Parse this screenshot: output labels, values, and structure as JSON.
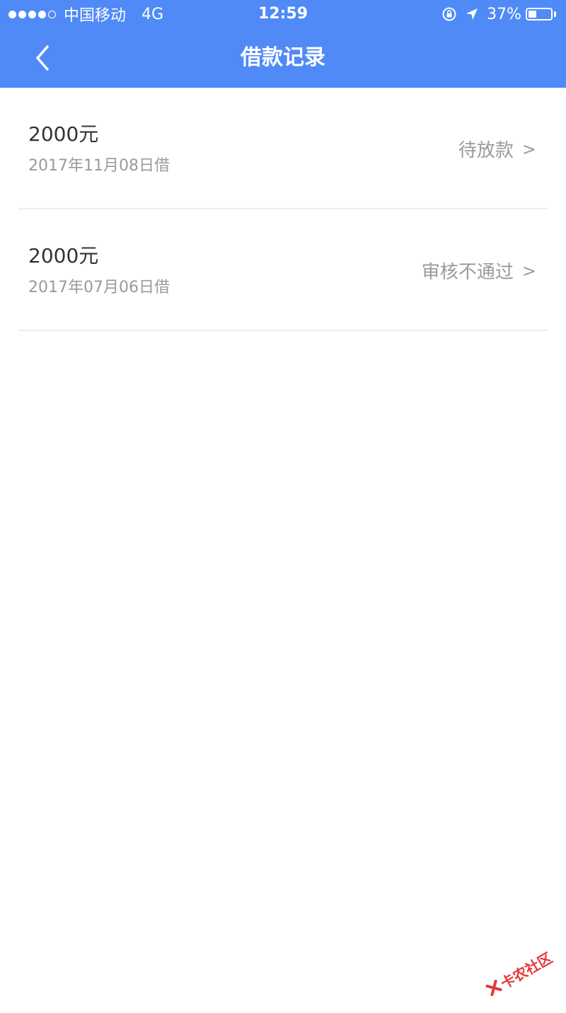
{
  "status_bar": {
    "carrier": "中国移动",
    "network": "4G",
    "time": "12:59",
    "battery_percent": "37%",
    "battery_level": 0.37,
    "signal_filled": 4,
    "signal_total": 5
  },
  "header": {
    "title": "借款记录",
    "background_color": "#4f8af7"
  },
  "records": [
    {
      "amount": "2000元",
      "date": "2017年11月08日借",
      "status": "待放款",
      "chevron": ">"
    },
    {
      "amount": "2000元",
      "date": "2017年07月06日借",
      "status": "审核不通过",
      "chevron": ">"
    }
  ],
  "watermark": {
    "text": "卡农社区"
  }
}
